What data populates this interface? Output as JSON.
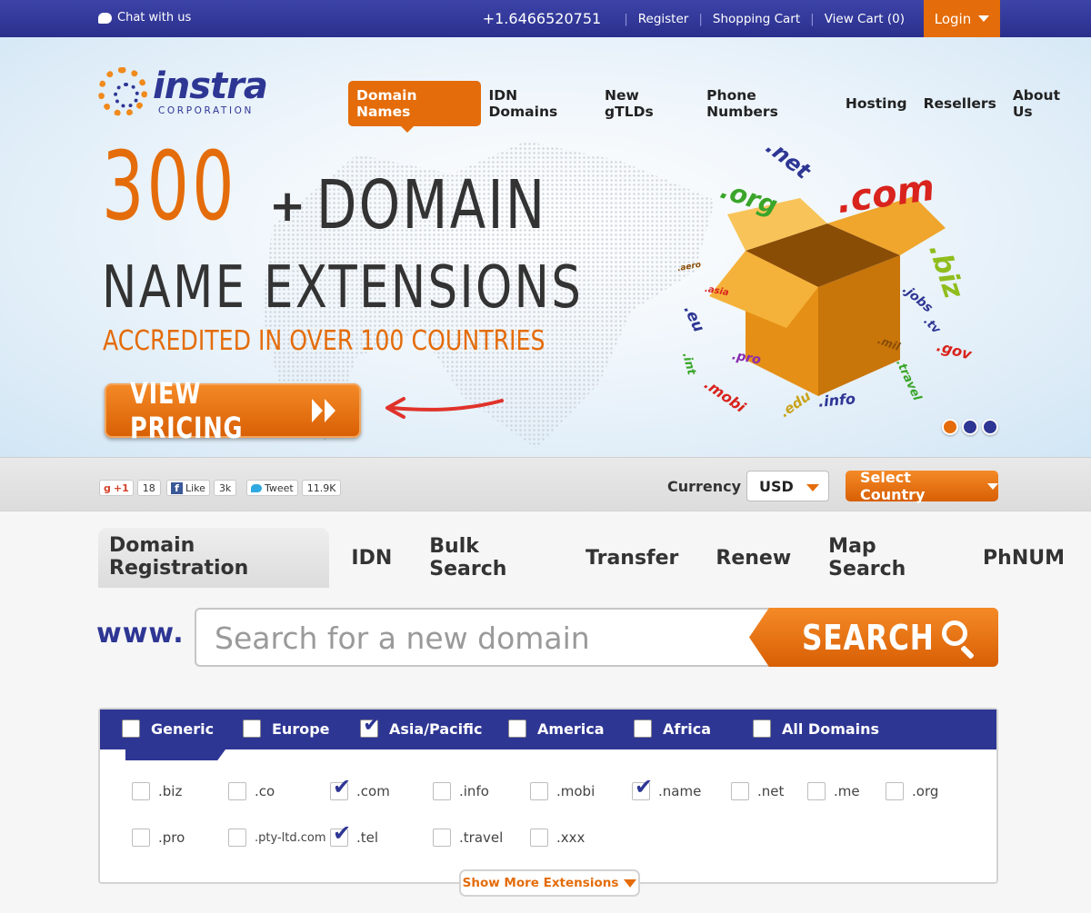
{
  "topbar": {
    "chat_label": "Chat with us",
    "phone": "+1.6466520751",
    "register": "Register",
    "shopping_cart": "Shopping Cart",
    "view_cart": "View Cart (0)",
    "login": "Login"
  },
  "logo": {
    "name": "instra",
    "subtitle": "CORPORATION"
  },
  "nav": {
    "items": [
      "Domain Names",
      "IDN Domains",
      "New gTLDs",
      "Phone Numbers",
      "Hosting",
      "Resellers",
      "About Us"
    ],
    "active": "Domain Names"
  },
  "hero": {
    "big_number": "300",
    "plus": "+",
    "line1": "DOMAIN",
    "line2": "NAME EXTENSIONS",
    "tagline": "ACCREDITED IN OVER 100 COUNTRIES",
    "cta": "VIEW PRICING",
    "box_tlds": [
      ".net",
      ".com",
      ".org",
      ".biz",
      ".jobs",
      ".tv",
      ".gov",
      ".mil",
      ".travel",
      ".info",
      ".edu",
      ".mobi",
      ".int",
      ".pro",
      ".eu",
      ".asia",
      ".aero"
    ],
    "slider_dots": [
      "#e46c0a",
      "#2e3694",
      "#2e3694"
    ]
  },
  "social": {
    "gplus_label": "+1",
    "gplus_count": "18",
    "fb_label": "Like",
    "fb_count": "3k",
    "tw_label": "Tweet",
    "tw_count": "11.9K"
  },
  "currency": {
    "label": "Currency",
    "selected": "USD",
    "country_button": "Select Country"
  },
  "tabs": {
    "items": [
      "Domain Registration",
      "IDN",
      "Bulk Search",
      "Transfer",
      "Renew",
      "Map Search",
      "PhNUM"
    ],
    "active": "Domain Registration"
  },
  "search": {
    "prefix": "www.",
    "placeholder": "Search for a new domain",
    "value": "",
    "button": "SEARCH"
  },
  "regions": [
    {
      "label": "Generic",
      "checked": false
    },
    {
      "label": "Europe",
      "checked": false
    },
    {
      "label": "Asia/Pacific",
      "checked": true
    },
    {
      "label": "America",
      "checked": false
    },
    {
      "label": "Africa",
      "checked": false
    },
    {
      "label": "All Domains",
      "checked": false
    }
  ],
  "extensions": [
    {
      "label": ".biz",
      "checked": false
    },
    {
      "label": ".co",
      "checked": false
    },
    {
      "label": ".com",
      "checked": true
    },
    {
      "label": ".info",
      "checked": false
    },
    {
      "label": ".mobi",
      "checked": false
    },
    {
      "label": ".name",
      "checked": true
    },
    {
      "label": ".net",
      "checked": false
    },
    {
      "label": ".me",
      "checked": false
    },
    {
      "label": ".org",
      "checked": false
    },
    {
      "label": ".pro",
      "checked": false
    },
    {
      "label": ".pty-ltd.com",
      "checked": false
    },
    {
      "label": ".tel",
      "checked": true
    },
    {
      "label": ".travel",
      "checked": false
    },
    {
      "label": ".xxx",
      "checked": false
    }
  ],
  "show_more": "Show More Extensions",
  "colors": {
    "brand_blue": "#2e3694",
    "brand_orange": "#e46c0a"
  }
}
